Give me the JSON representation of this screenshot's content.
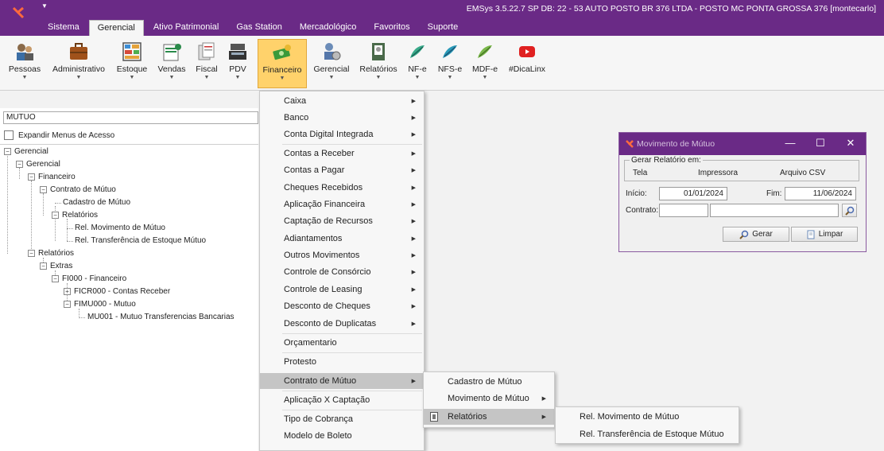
{
  "app": {
    "title": "EMSys 3.5.22.7 SP DB: 22 - 53 AUTO POSTO BR 376 LTDA - POSTO MC PONTA GROSSA 376 [montecarlo]",
    "brand_color": "#6a2a86",
    "accent_color": "#ffd26b"
  },
  "menu_tabs": [
    {
      "label": "Sistema"
    },
    {
      "label": "Gerencial",
      "active": true
    },
    {
      "label": "Ativo Patrimonial"
    },
    {
      "label": "Gas Station"
    },
    {
      "label": "Mercadológico"
    },
    {
      "label": "Favoritos"
    },
    {
      "label": "Suporte"
    }
  ],
  "ribbon": [
    {
      "label": "Pessoas",
      "icon": "people-icon"
    },
    {
      "label": "Administrativo",
      "icon": "briefcase-icon"
    },
    {
      "label": "Estoque",
      "icon": "shelves-icon"
    },
    {
      "label": "Vendas",
      "icon": "sales-icon"
    },
    {
      "label": "Fiscal",
      "icon": "documents-icon"
    },
    {
      "label": "PDV",
      "icon": "cash-register-icon"
    },
    {
      "label": "Financeiro",
      "icon": "money-icon",
      "active": true
    },
    {
      "label": "Gerencial",
      "icon": "manager-icon"
    },
    {
      "label": "Relatórios",
      "icon": "report-icon"
    },
    {
      "label": "NF-e",
      "icon": "nfe-icon"
    },
    {
      "label": "NFS-e",
      "icon": "nfse-icon"
    },
    {
      "label": "MDF-e",
      "icon": "mdfe-icon"
    },
    {
      "label": "#DicaLinx",
      "icon": "youtube-icon"
    }
  ],
  "left_panel": {
    "search_value": "MUTUO",
    "expand_label": "Expandir Menus de Acesso",
    "tree": [
      {
        "label": "Gerencial",
        "toggle": "−"
      },
      {
        "label": "Gerencial",
        "toggle": "−"
      },
      {
        "label": "Financeiro",
        "toggle": "−"
      },
      {
        "label": "Contrato de Mútuo",
        "toggle": "−"
      },
      {
        "label": "Cadastro de Mútuo",
        "toggle": ""
      },
      {
        "label": "Relatórios",
        "toggle": "−"
      },
      {
        "label": "Rel. Movimento de Mútuo",
        "toggle": ""
      },
      {
        "label": "Rel. Transferência de Estoque Mútuo",
        "toggle": ""
      },
      {
        "label": "Relatórios",
        "toggle": "−"
      },
      {
        "label": "Extras",
        "toggle": "−"
      },
      {
        "label": "FI000 - Financeiro",
        "toggle": "−"
      },
      {
        "label": "FICR000 - Contas Receber",
        "toggle": "+"
      },
      {
        "label": "FIMU000 - Mutuo",
        "toggle": "−"
      },
      {
        "label": "MU001 - Mutuo Transferencias Bancarias",
        "toggle": ""
      }
    ]
  },
  "financeiro_menu": [
    {
      "label": "Caixa",
      "submenu": true
    },
    {
      "label": "Banco",
      "submenu": true
    },
    {
      "label": "Conta Digital Integrada",
      "submenu": true
    },
    {
      "label": "Contas a Receber",
      "submenu": true
    },
    {
      "label": "Contas a Pagar",
      "submenu": true
    },
    {
      "label": "Cheques Recebidos",
      "submenu": true
    },
    {
      "label": "Aplicação Financeira",
      "submenu": true
    },
    {
      "label": "Captação de Recursos",
      "submenu": true
    },
    {
      "label": "Adiantamentos",
      "submenu": true
    },
    {
      "label": "Outros Movimentos",
      "submenu": true
    },
    {
      "label": "Controle de Consórcio",
      "submenu": true
    },
    {
      "label": "Controle de Leasing",
      "submenu": true
    },
    {
      "label": "Desconto de Cheques",
      "submenu": true
    },
    {
      "label": "Desconto de Duplicatas",
      "submenu": true
    },
    {
      "label": "Orçamentario",
      "submenu": false
    },
    {
      "label": "Protesto",
      "submenu": false
    },
    {
      "label": "Contrato de Mútuo",
      "submenu": true,
      "highlighted": true
    },
    {
      "label": "Aplicação X Captação",
      "submenu": false
    },
    {
      "label": "Tipo de Cobrança",
      "submenu": false
    },
    {
      "label": "Modelo de Boleto",
      "submenu": false
    }
  ],
  "contrato_menu": [
    {
      "label": "Cadastro de Mútuo",
      "submenu": false
    },
    {
      "label": "Movimento de Mútuo",
      "submenu": true
    },
    {
      "label": "Relatórios",
      "submenu": true,
      "highlighted": true
    }
  ],
  "relatorios_menu": [
    {
      "label": "Rel. Movimento de Mútuo"
    },
    {
      "label": "Rel. Transferência de Estoque Mútuo"
    }
  ],
  "dialog": {
    "title": "Movimento de Mútuo",
    "group_label": "Gerar Relatório em:",
    "options": [
      "Tela",
      "Impressora",
      "Arquivo CSV"
    ],
    "inicio_label": "Início:",
    "inicio_value": "01/01/2024",
    "fim_label": "Fim:",
    "fim_value": "11/06/2024",
    "contrato_label": "Contrato:",
    "gerar_label": "Gerar",
    "limpar_label": "Limpar"
  }
}
